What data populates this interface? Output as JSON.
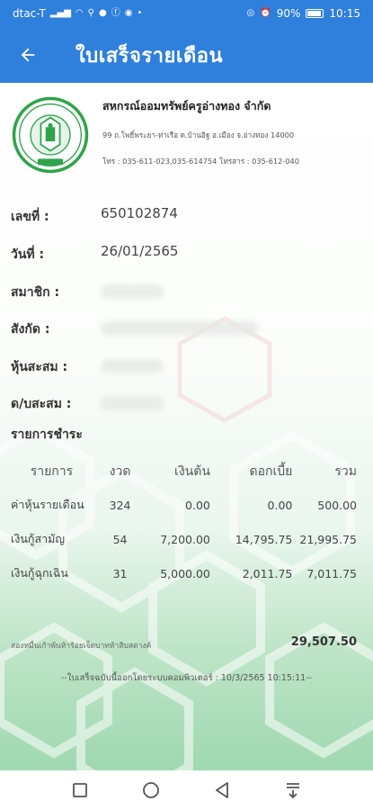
{
  "status": {
    "carrier": "dtac-T",
    "battery": "90%",
    "time": "10:15"
  },
  "appbar": {
    "title": "ใบเสร็จรายเดือน",
    "back_icon": "arrow-left-icon"
  },
  "org": {
    "name": "สหกรณ์ออมทรัพย์ครูอ่างทอง จำกัด",
    "address": "99 ถ.โพธิ์พระยา-ท่าเรือ ต.บ้านอิฐ อ.เมือง จ.อ่างทอง 14000",
    "phones": "โทร : 035-611-023,035-614754 โทรสาร : 035-612-040"
  },
  "fields": {
    "number_label": "เลขที่ :",
    "number_value": "650102874",
    "date_label": "วันที่ :",
    "date_value": "26/01/2565",
    "member_label": "สมาชิก :",
    "affiliation_label": "สังกัด :",
    "shares_label": "หุ้นสะสม :",
    "interest_label": "ด/บสะสม :"
  },
  "payments": {
    "title": "รายการชำระ",
    "headers": {
      "item": "รายการ",
      "period": "งวด",
      "principal": "เงินต้น",
      "interest": "ดอกเบี้ย",
      "total": "รวม"
    },
    "rows": [
      {
        "item": "ค่าหุ้นรายเดือน",
        "period": "324",
        "principal": "0.00",
        "interest": "0.00",
        "total": "500.00"
      },
      {
        "item": "เงินกู้สามัญ",
        "period": "54",
        "principal": "7,200.00",
        "interest": "14,795.75",
        "total": "21,995.75"
      },
      {
        "item": "เงินกู้ฉุกเฉิน",
        "period": "31",
        "principal": "5,000.00",
        "interest": "2,011.75",
        "total": "7,011.75"
      }
    ],
    "total_text": "สองหมื่นเก้าพันห้าร้อยเจ็ดบาทห้าสิบสตางค์",
    "total_value": "29,507.50"
  },
  "footer_note": "--ใบเสร็จฉบับนี้ออกโดยระบบคอมพิวเตอร์ : 10/3/2565 10:15:11--",
  "colors": {
    "primary": "#2f7fdc",
    "logo_green": "#2fa34a",
    "watermark": "#8fd3a0"
  }
}
